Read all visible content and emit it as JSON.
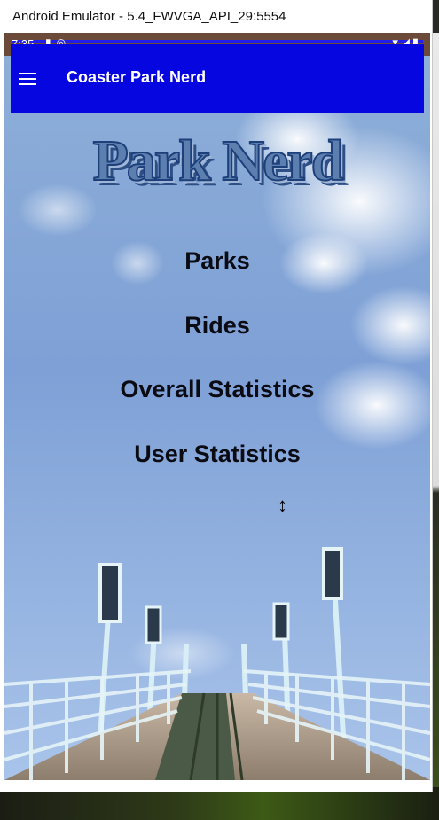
{
  "window": {
    "title": "Android Emulator - 5.4_FWVGA_API_29:5554"
  },
  "status_bar": {
    "time": "7:35",
    "left_icons": "sd-card-icon, do-not-disturb-icon",
    "right_icons": "wifi-icon, signal-icon, battery-icon"
  },
  "app_bar": {
    "title": "Coaster Park Nerd",
    "menu_icon": "hamburger-menu-icon"
  },
  "logo": {
    "text": "Park Nerd"
  },
  "menu": {
    "items": [
      {
        "label": "Parks"
      },
      {
        "label": "Rides"
      },
      {
        "label": "Overall Statistics"
      },
      {
        "label": "User Statistics"
      }
    ]
  },
  "colors": {
    "app_bar": "#0606e0",
    "status_bar": "#6b4a3a",
    "menu_text": "#0b0b14"
  }
}
